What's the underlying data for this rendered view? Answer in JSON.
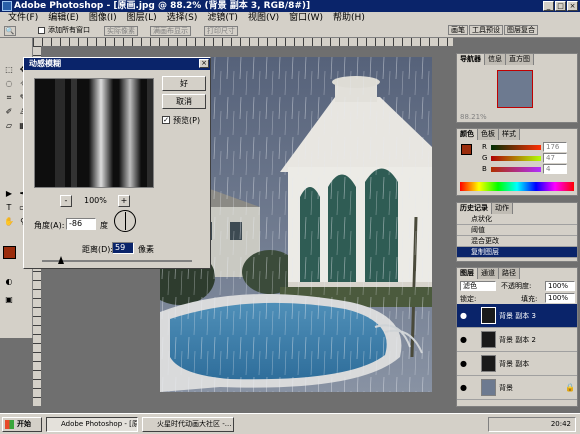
{
  "app": {
    "title": "Adobe Photoshop - [原画.jpg @ 88.2% (背景 副本 3, RGB/8#)]"
  },
  "menu": [
    "文件(F)",
    "编辑(E)",
    "图像(I)",
    "图层(L)",
    "选择(S)",
    "滤镜(T)",
    "视图(V)",
    "窗口(W)",
    "帮助(H)"
  ],
  "options": {
    "all_windows": "添加所有窗口",
    "actual_pixels": "实际像素",
    "fit_screen": "满画布显示",
    "print_size": "打印尺寸"
  },
  "palette_well": [
    "画笔",
    "工具预设",
    "图层复合"
  ],
  "dialog": {
    "title": "动感模糊",
    "ok": "好",
    "cancel": "取消",
    "preview": "预览(P)",
    "zoom_minus": "-",
    "zoom_value": "100%",
    "zoom_plus": "+",
    "angle_label": "角度(A):",
    "angle_value": "-86",
    "angle_unit": "度",
    "distance_label": "距离(D):",
    "distance_value": "59",
    "distance_unit": "像素"
  },
  "navigator": {
    "tabs": [
      "导航器",
      "信息",
      "直方图"
    ],
    "zoom": "88.21%"
  },
  "color": {
    "tabs": [
      "颜色",
      "色板",
      "样式"
    ],
    "channels": [
      {
        "label": "R",
        "value": "176"
      },
      {
        "label": "G",
        "value": "47"
      },
      {
        "label": "B",
        "value": "4"
      }
    ]
  },
  "history": {
    "tabs": [
      "历史记录",
      "动作"
    ],
    "items": [
      "点状化",
      "阈值",
      "混合更改",
      "复制图层"
    ]
  },
  "layers": {
    "tabs": [
      "图层",
      "通道",
      "路径"
    ],
    "blend_mode": "滤色",
    "opacity_label": "不透明度:",
    "opacity_value": "100%",
    "lock_label": "锁定:",
    "fill_label": "填充:",
    "fill_value": "100%",
    "items": [
      {
        "name": "背景 副本 3",
        "active": true
      },
      {
        "name": "背景 副本 2",
        "active": false
      },
      {
        "name": "背景 副本",
        "active": false
      },
      {
        "name": "背景",
        "active": false
      }
    ]
  },
  "taskbar": {
    "start": "开始",
    "tasks": [
      "Adobe Photoshop - [原画...",
      "火星时代动画大社区 -..."
    ],
    "clock": "20:42"
  },
  "colors": {
    "foreground": "#9a2c0c",
    "titlebar": "#0a246a",
    "selection": "#0a246a"
  }
}
